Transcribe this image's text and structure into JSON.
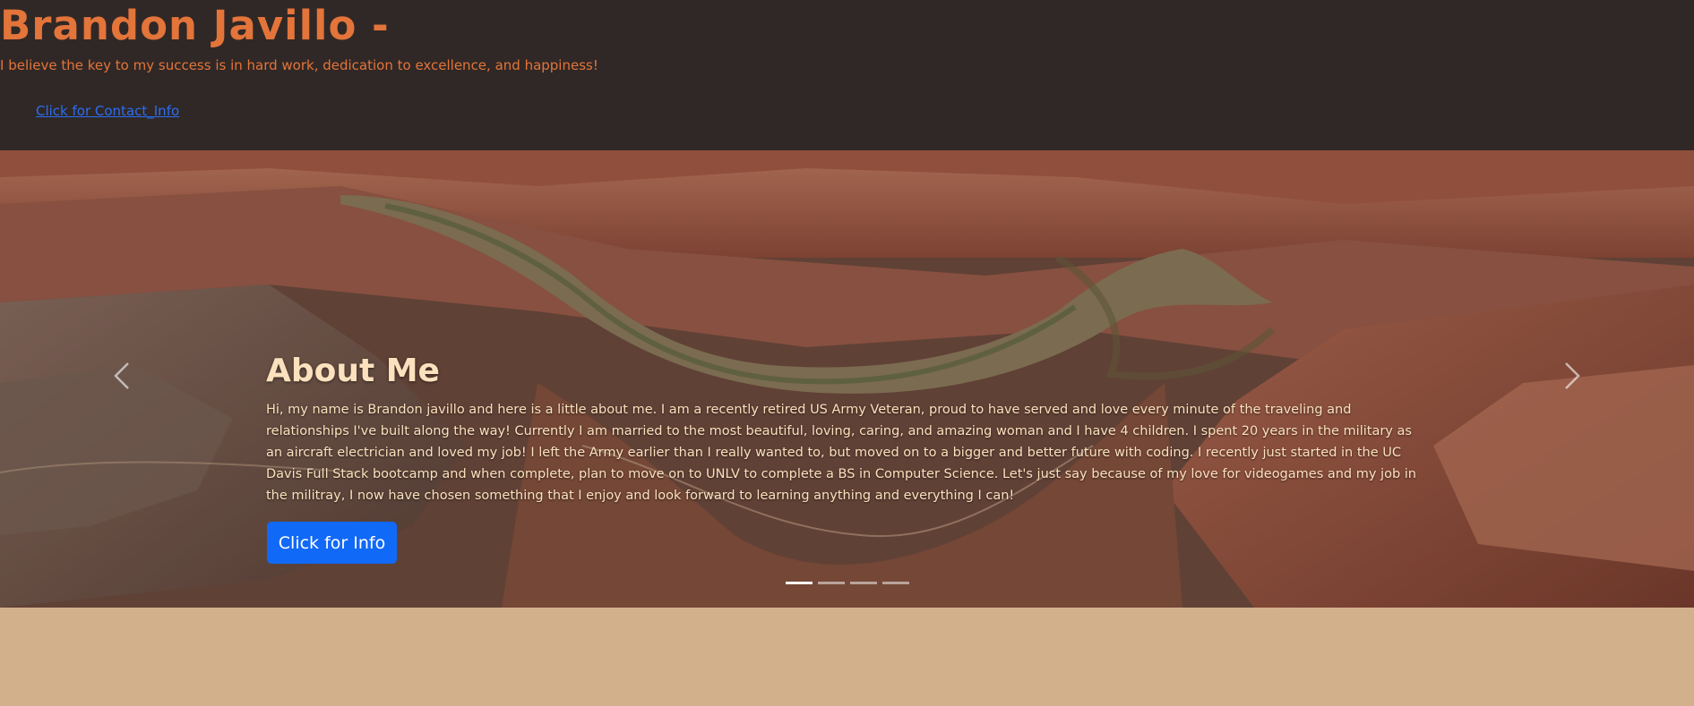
{
  "header": {
    "title": "Brandon Javillo -",
    "tagline": "I believe the key to my success is in hard work, dedication to excellence, and happiness!",
    "contact_link": "Click for Contact_Info"
  },
  "carousel": {
    "caption_title": "About Me",
    "caption_text": "Hi, my name is Brandon javillo and here is a little about me. I am a recently retired US Army Veteran, proud to have served and love every minute of the traveling and relationships I've built along the way! Currently I am married to the most beautiful, loving, caring, and amazing woman and I have 4 children. I spent 20 years in the military as an aircraft electrician and loved my job! I left the Army earlier than I really wanted to, but moved on to a bigger and better future with coding. I recently just started in the UC Davis Full Stack bootcamp and when complete, plan to move on to UNLV to complete a BS in Computer Science. Let's just say because of my love for videogames and my job in the militray, I now have chosen something that I enjoy and look forward to learning anything and everything I can!",
    "button_label": "Click for Info",
    "active_slide": 1,
    "slide_count": 4
  },
  "colors": {
    "header_bg": "#302826",
    "accent_orange": "#e3743a",
    "link_blue": "#2b6df2",
    "button_blue": "#1169f7",
    "caption_text": "#fbe1bd",
    "page_bg": "#d2b08c"
  },
  "icons": {
    "prev": "chevron-left-icon",
    "next": "chevron-right-icon"
  }
}
